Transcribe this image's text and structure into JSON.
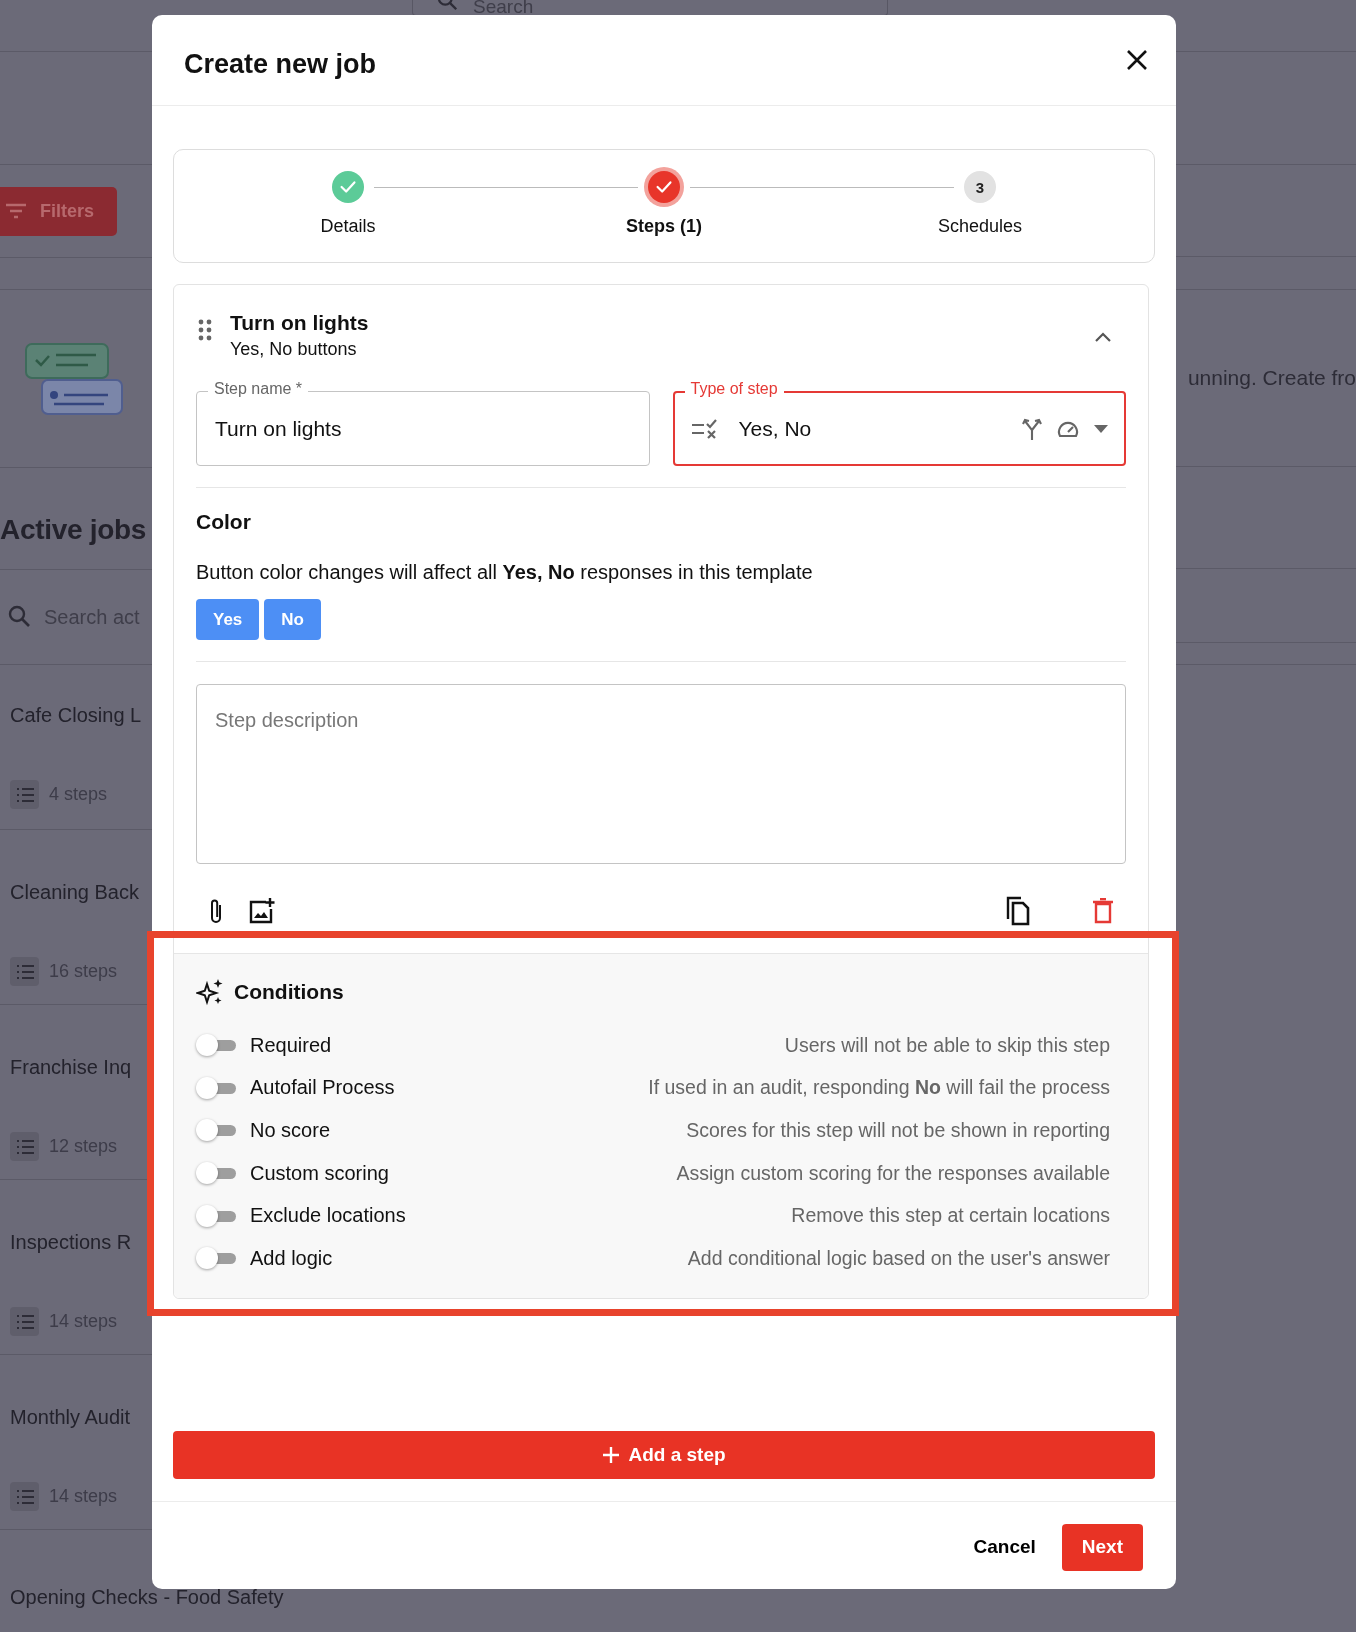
{
  "background": {
    "top_search": {
      "placeholder": "Search"
    },
    "filters_button": "Filters",
    "empty_state_text": "unning. Create fro",
    "heading": "Active jobs",
    "job_search": {
      "placeholder": "Search act"
    },
    "jobs": [
      {
        "title": "Cafe Closing L",
        "steps": "4 steps"
      },
      {
        "title": "Cleaning Back",
        "steps": "16 steps"
      },
      {
        "title": "Franchise Inq",
        "steps": "12 steps"
      },
      {
        "title": "Inspections R",
        "steps": "14 steps"
      },
      {
        "title": "Monthly Audit",
        "steps": "14 steps"
      },
      {
        "title": "Opening Checks - Food Safety"
      }
    ]
  },
  "dialog": {
    "title": "Create new job",
    "stepper": [
      {
        "label": "Details",
        "completed": true,
        "selected": false
      },
      {
        "label": "Steps (1)",
        "completed": true,
        "selected": true
      },
      {
        "label": "Schedules",
        "completed": false,
        "selected": false,
        "number": "3"
      }
    ],
    "step": {
      "title": "Turn on lights",
      "subtitle": "Yes, No buttons",
      "expanded": true,
      "name_field": {
        "label": "Step name *",
        "value": "Turn on lights"
      },
      "type_field": {
        "label": "Type of step",
        "value": "Yes, No",
        "focused": true
      },
      "color": {
        "heading": "Color",
        "note": "Button color changes will affect all **Yes, No** responses in this template",
        "buttons": [
          {
            "label": "Yes",
            "color": "#4d8ff5"
          },
          {
            "label": "No",
            "color": "#4d8ff5"
          }
        ]
      },
      "description": {
        "placeholder": "Step description"
      },
      "conditions": {
        "heading": "Conditions",
        "highlighted": true,
        "items": [
          {
            "label": "Required",
            "description": "Users will not be able to skip this step",
            "on": false
          },
          {
            "label": "Autofail Process",
            "description": "If used in an audit, responding **No** will fail the process",
            "on": false
          },
          {
            "label": "No score",
            "description": "Scores for this step will not be shown in reporting",
            "on": false
          },
          {
            "label": "Custom scoring",
            "description": "Assign custom scoring for the responses available",
            "on": false
          },
          {
            "label": "Exclude locations",
            "description": "Remove this step at certain locations",
            "on": false
          },
          {
            "label": "Add logic",
            "description": "Add conditional logic based on the user's answer",
            "on": false
          }
        ]
      }
    },
    "add_step_button": "Add a step",
    "cancel_button": "Cancel",
    "next_button": "Next"
  }
}
